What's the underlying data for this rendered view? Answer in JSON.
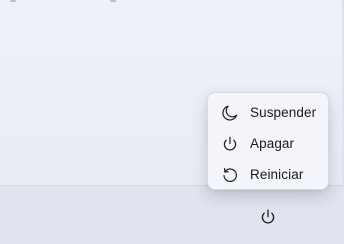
{
  "power_menu": {
    "items": [
      {
        "label": "Suspender",
        "icon": "moon-icon"
      },
      {
        "label": "Apagar",
        "icon": "power-icon"
      },
      {
        "label": "Reiniciar",
        "icon": "restart-icon"
      }
    ]
  },
  "footer": {
    "power_button_icon": "power-icon"
  },
  "colors": {
    "panel_background": "#eef1f8",
    "footer_background": "#dfe4ef",
    "menu_background": "#f3f5fa",
    "text": "#1b1b1b",
    "icon_stroke": "#1f1f1f"
  }
}
